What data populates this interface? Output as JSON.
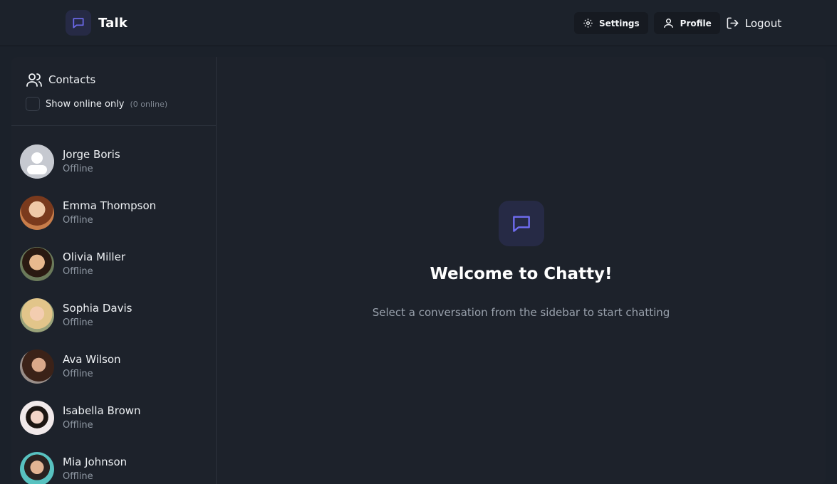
{
  "navbar": {
    "brand": "Talk",
    "settings_label": "Settings",
    "profile_label": "Profile",
    "logout_label": "Logout"
  },
  "sidebar": {
    "title": "Contacts",
    "online_filter_label": "Show online only",
    "online_count": "(0 online)",
    "contacts": [
      {
        "name": "Jorge Boris",
        "status": "Offline"
      },
      {
        "name": "Emma Thompson",
        "status": "Offline"
      },
      {
        "name": "Olivia Miller",
        "status": "Offline"
      },
      {
        "name": "Sophia Davis",
        "status": "Offline"
      },
      {
        "name": "Ava Wilson",
        "status": "Offline"
      },
      {
        "name": "Isabella Brown",
        "status": "Offline"
      },
      {
        "name": "Mia Johnson",
        "status": "Offline"
      }
    ]
  },
  "welcome": {
    "title": "Welcome to Chatty!",
    "subtitle": "Select a conversation from the sidebar to start chatting"
  },
  "colors": {
    "accent": "#6f6cf0",
    "background": "#1b212a",
    "panel": "#1d222b"
  }
}
